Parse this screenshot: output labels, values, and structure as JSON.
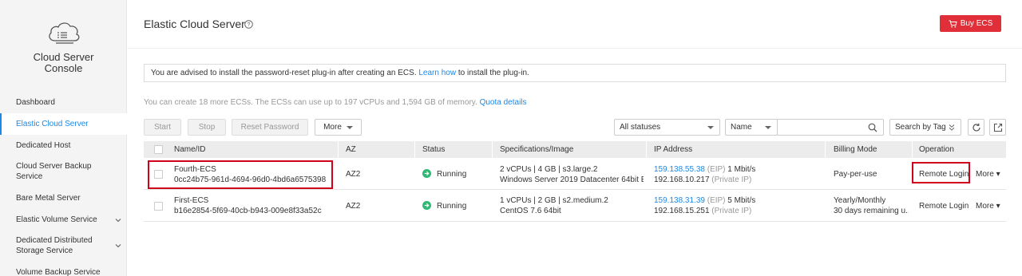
{
  "sidebar": {
    "title_line1": "Cloud Server",
    "title_line2": "Console",
    "items": [
      {
        "label": "Dashboard"
      },
      {
        "label": "Elastic Cloud Server"
      },
      {
        "label": "Dedicated Host"
      },
      {
        "label": "Cloud Server Backup Service"
      },
      {
        "label": "Bare Metal Server"
      },
      {
        "label": "Elastic Volume Service"
      },
      {
        "label": "Dedicated Distributed Storage Service"
      },
      {
        "label": "Volume Backup Service"
      }
    ]
  },
  "header": {
    "title": "Elastic Cloud Server",
    "buy_label": "Buy ECS"
  },
  "notice": {
    "text_before": "You are advised to install the password-reset plug-in after creating an ECS.",
    "link": "Learn how",
    "text_after": "to install the plug-in."
  },
  "quota": {
    "text": "You can create 18 more ECSs. The ECSs can use up to 197 vCPUs and 1,594 GB of memory.",
    "link": "Quota details"
  },
  "toolbar": {
    "start": "Start",
    "stop": "Stop",
    "reset_password": "Reset Password",
    "more": "More",
    "status_filter": "All statuses",
    "search_field": "Name",
    "search_value": "",
    "search_by_tag": "Search by Tag"
  },
  "table": {
    "columns": [
      "Name/ID",
      "AZ",
      "Status",
      "Specifications/Image",
      "IP Address",
      "Billing Mode",
      "Operation"
    ],
    "rows": [
      {
        "name": "Fourth-ECS",
        "id": "0cc24b75-961d-4694-96d0-4bd6a6575398",
        "az": "AZ2",
        "status": "Running",
        "spec": "2 vCPUs | 4 GB | s3.large.2",
        "image": "Windows Server 2019 Datacenter 64bit E...",
        "eip": "159.138.55.38",
        "eip_tag": "(EIP)",
        "bandwidth": "1 Mbit/s",
        "private_ip": "192.168.10.217",
        "private_tag": "(Private IP)",
        "billing": "Pay-per-use",
        "billing_sub": "",
        "op_remote": "Remote Login",
        "op_more": "More"
      },
      {
        "name": "First-ECS",
        "id": "b16e2854-5f69-40cb-b943-009e8f33a52c",
        "az": "AZ2",
        "status": "Running",
        "spec": "1 vCPUs | 2 GB | s2.medium.2",
        "image": "CentOS 7.6 64bit",
        "eip": "159.138.31.39",
        "eip_tag": "(EIP)",
        "bandwidth": "5 Mbit/s",
        "private_ip": "192.168.15.251",
        "private_tag": "(Private IP)",
        "billing": "Yearly/Monthly",
        "billing_sub": "30 days remaining u...",
        "op_remote": "Remote Login",
        "op_more": "More"
      }
    ]
  },
  "colors": {
    "accent": "#1e88e5",
    "buy": "#e02f38",
    "running": "#2eb872",
    "highlight": "#d0021b"
  }
}
